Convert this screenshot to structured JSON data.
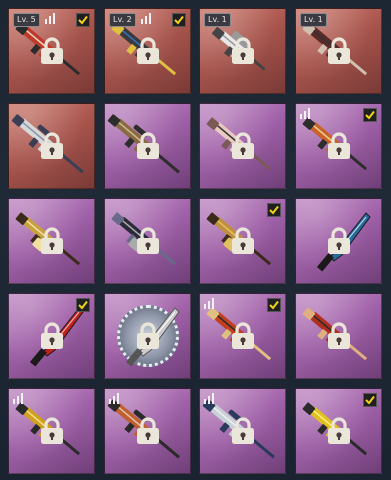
{
  "colors": {
    "red_tile": "#a8554d",
    "purple_tile": "#a061a8",
    "check_mark": "#f2d21b",
    "lock": "#ebe6da"
  },
  "tiles": [
    {
      "rarity": "red",
      "level": "Lv. 5",
      "bars": true,
      "checked": true,
      "weapon": "rifle",
      "icon": "red-tiger-rifle-icon"
    },
    {
      "rarity": "red",
      "level": "Lv. 2",
      "bars": true,
      "checked": true,
      "weapon": "rifle",
      "icon": "colorful-rifle-icon"
    },
    {
      "rarity": "red",
      "level": "Lv. 1",
      "bars": false,
      "checked": false,
      "weapon": "smg",
      "icon": "white-smg-icon"
    },
    {
      "rarity": "red",
      "level": "Lv. 1",
      "bars": false,
      "checked": false,
      "weapon": "rifle",
      "icon": "dark-rifle-icon"
    },
    {
      "rarity": "red",
      "level": "",
      "bars": false,
      "checked": false,
      "weapon": "sniper",
      "icon": "camo-sniper-icon"
    },
    {
      "rarity": "purple",
      "level": "",
      "bars": false,
      "checked": false,
      "weapon": "sniper",
      "icon": "wood-sniper-icon"
    },
    {
      "rarity": "purple",
      "level": "",
      "bars": false,
      "checked": false,
      "weapon": "rifle",
      "icon": "pink-rifle-icon"
    },
    {
      "rarity": "purple",
      "level": "",
      "bars": true,
      "checked": true,
      "weapon": "rifle",
      "icon": "orange-rifle-icon"
    },
    {
      "rarity": "purple",
      "level": "",
      "bars": false,
      "checked": false,
      "weapon": "lmg",
      "icon": "gold-lmg-icon"
    },
    {
      "rarity": "purple",
      "level": "",
      "bars": false,
      "checked": false,
      "weapon": "lmg",
      "icon": "dark-lmg-icon"
    },
    {
      "rarity": "purple",
      "level": "",
      "bars": false,
      "checked": true,
      "weapon": "lmg",
      "icon": "gold-lmg-icon-2"
    },
    {
      "rarity": "purple",
      "level": "",
      "bars": false,
      "checked": false,
      "weapon": "knife",
      "icon": "blue-machete-icon"
    },
    {
      "rarity": "purple",
      "level": "",
      "bars": false,
      "checked": true,
      "weapon": "knife",
      "icon": "red-machete-icon"
    },
    {
      "rarity": "purple",
      "level": "",
      "bars": false,
      "checked": false,
      "weapon": "ring",
      "icon": "spiked-shield-icon"
    },
    {
      "rarity": "purple",
      "level": "",
      "bars": true,
      "checked": true,
      "weapon": "shotgun",
      "icon": "red-shotgun-icon"
    },
    {
      "rarity": "purple",
      "level": "",
      "bars": false,
      "checked": false,
      "weapon": "shotgun",
      "icon": "red-shotgun-icon-2"
    },
    {
      "rarity": "purple",
      "level": "",
      "bars": true,
      "checked": false,
      "weapon": "rifle",
      "icon": "gold-rifle-icon"
    },
    {
      "rarity": "purple",
      "level": "",
      "bars": true,
      "checked": false,
      "weapon": "sniper",
      "icon": "orange-sniper-icon"
    },
    {
      "rarity": "purple",
      "level": "",
      "bars": true,
      "checked": false,
      "weapon": "sniper",
      "icon": "silver-sniper-icon"
    },
    {
      "rarity": "purple",
      "level": "",
      "bars": false,
      "checked": true,
      "weapon": "rifle",
      "icon": "yellow-rifle-icon"
    }
  ]
}
